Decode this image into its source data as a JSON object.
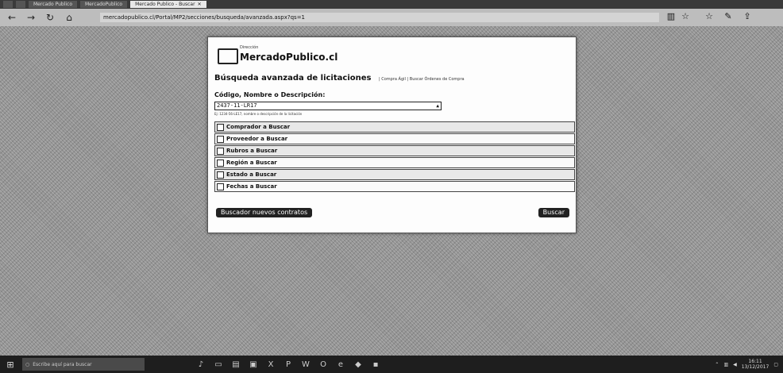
{
  "browser": {
    "tabs": [
      {
        "label": "",
        "active": false
      },
      {
        "label": "",
        "active": false
      },
      {
        "label": "Mercado Publico",
        "active": false
      },
      {
        "label": "MercadoPublico",
        "active": false
      },
      {
        "label": "Mercado Publico - Buscar",
        "active": true
      }
    ],
    "url": "mercadopublico.cl/Portal/MP2/secciones/busqueda/avanzada.aspx?qs=1",
    "icons": {
      "back": "back-arrow-icon",
      "refresh": "refresh-icon",
      "home": "home-icon",
      "reader": "reading-view-icon",
      "favorite": "star-icon",
      "favorites_hub": "favorites-hub-icon",
      "notes": "pen-icon",
      "share": "share-icon"
    }
  },
  "dialog": {
    "logo_small": "Dirección",
    "logo_text": "MercadoPublico.cl",
    "title": "Búsqueda avanzada de licitaciones",
    "title_links": "| Compra Ágil | Buscar Órdenes de Compra",
    "field_label": "Código, Nombre o Descripción:",
    "search_value": "2437-11-LR17",
    "hint": "Ej: 1234-56-LE17, nombre o descripción de la licitación",
    "filters": [
      "Comprador a Buscar",
      "Proveedor a Buscar",
      "Rubros a Buscar",
      "Región a Buscar",
      "Estado a Buscar",
      "Fechas a Buscar"
    ],
    "left_button": "Buscador nuevos contratos",
    "right_button": "Buscar"
  },
  "taskbar": {
    "search_placeholder": "Escribe aquí para buscar",
    "clock": "16:11",
    "date": "13/12/2017"
  }
}
